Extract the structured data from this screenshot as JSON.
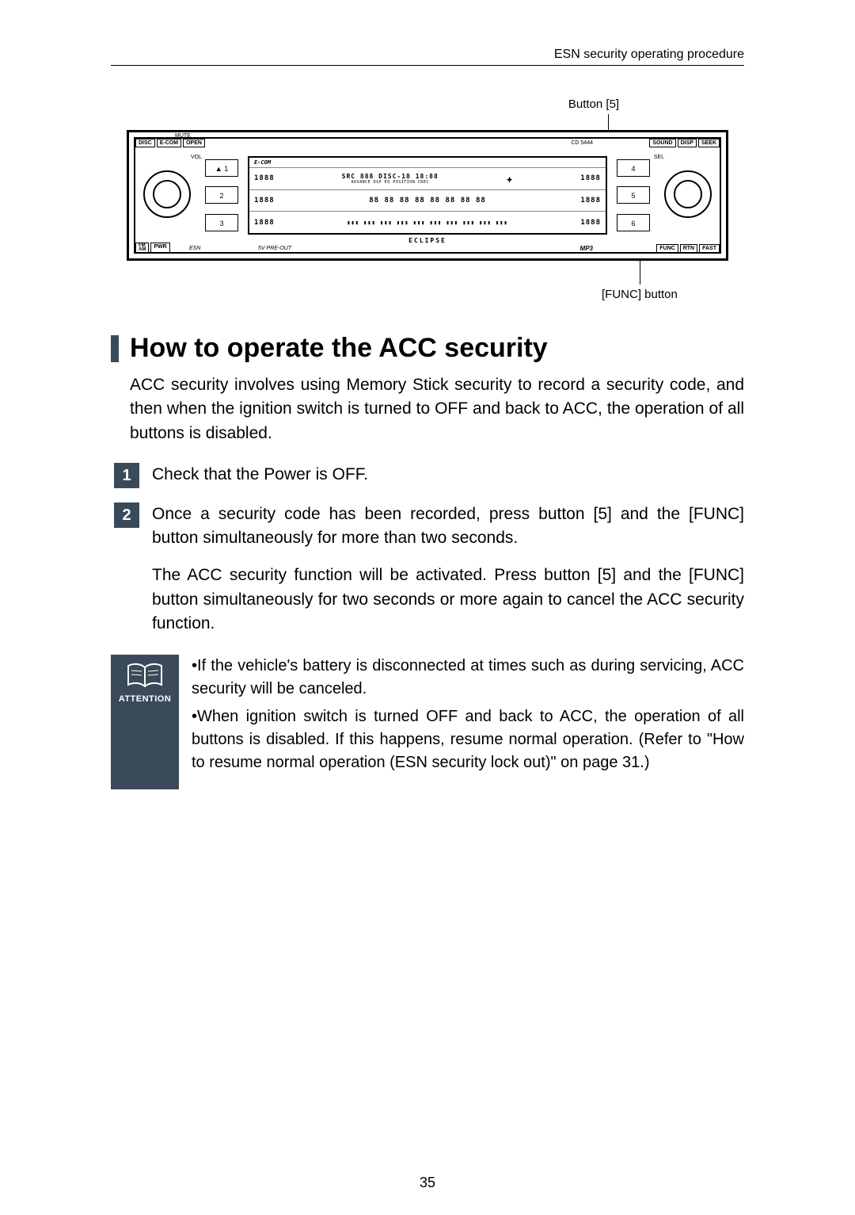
{
  "header": {
    "breadcrumb": "ESN security operating procedure"
  },
  "diagram": {
    "label_top": "Button [5]",
    "label_bottom": "[FUNC] button",
    "stereo": {
      "top_left_chips": [
        "DISC",
        "E-COM",
        "OPEN"
      ],
      "top_mute": "MUTE",
      "top_right_chips": [
        "SOUND",
        "DISP",
        "SEEK"
      ],
      "cd_model": "CD 5444",
      "brand_logo": "E-COM",
      "vol": "VOL",
      "sel": "SEL",
      "esn": "ESN",
      "fm_am": "FM\nAM",
      "pwr": "PWR",
      "func": "FUNC",
      "rtn": "RTN",
      "fast": "FAST",
      "preout": "5V PRE-OUT",
      "mp3": "MP3",
      "eclipse": "ECLIPSE",
      "presets_left": [
        "▲  1",
        "2",
        "3"
      ],
      "presets_right": [
        "4",
        "5",
        "6"
      ],
      "lcd_rows": [
        {
          "left": "1888",
          "mid": "SRC 888  DISC-18  18:88",
          "indicators": "ADVANCE DSP EQ POSITION CREC",
          "right": "1888"
        },
        {
          "left": "1888",
          "mid": "88 88 88 88 88 88 88 88",
          "right": "1888"
        },
        {
          "left": "1888",
          "mid": "▮▮▮ ▮▮▮ ▮▮▮ ▮▮▮ ▮▮▮ ▮▮▮ ▮▮▮ ▮▮▮ ▮▮▮ ▮▮▮",
          "right": "1888"
        }
      ]
    }
  },
  "section": {
    "title": "How to operate the ACC security",
    "intro": "ACC security involves using Memory Stick security to record a security code, and then when the ignition switch is turned to OFF and back to ACC, the operation of all buttons is disabled.",
    "steps": [
      {
        "num": "1",
        "title": "Check that the Power is OFF.",
        "detail": ""
      },
      {
        "num": "2",
        "title": "Once a security code has been recorded, press button [5] and the [FUNC] button simultaneously for more than two seconds.",
        "detail": "The ACC security function will be activated. Press button [5] and the [FUNC] button simultaneously for two seconds or more again to cancel the ACC security function."
      }
    ],
    "attention": {
      "label": "ATTENTION",
      "bullets": [
        "If the vehicle's battery is disconnected at times such as during servicing, ACC security will be canceled.",
        "When ignition switch is turned OFF and back to ACC, the operation of all buttons is disabled. If this happens, resume normal operation. (Refer to \"How to resume normal operation (ESN security lock out)\" on page 31.)"
      ]
    }
  },
  "page_number": "35"
}
